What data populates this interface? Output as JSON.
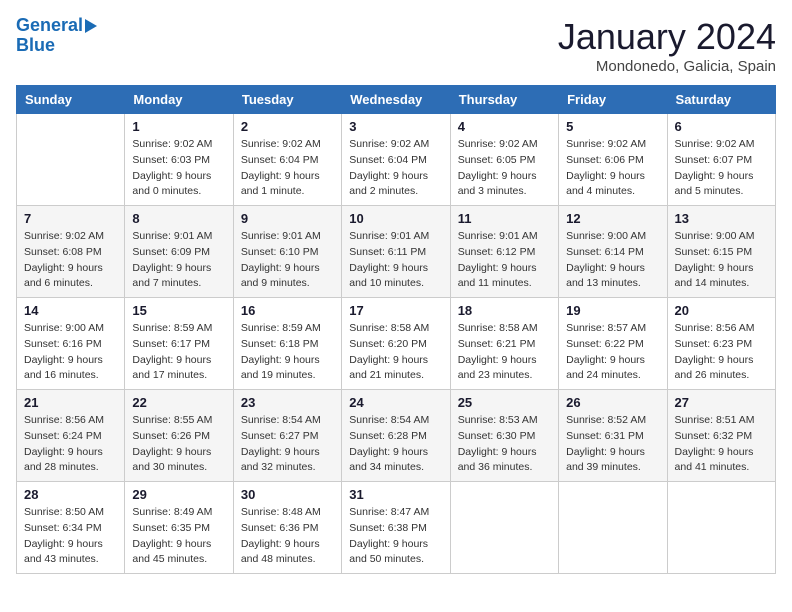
{
  "header": {
    "logo_line1": "General",
    "logo_line2": "Blue",
    "month": "January 2024",
    "location": "Mondonedo, Galicia, Spain"
  },
  "weekdays": [
    "Sunday",
    "Monday",
    "Tuesday",
    "Wednesday",
    "Thursday",
    "Friday",
    "Saturday"
  ],
  "weeks": [
    [
      {
        "day": "",
        "sunrise": "",
        "sunset": "",
        "daylight": ""
      },
      {
        "day": "1",
        "sunrise": "9:02 AM",
        "sunset": "6:03 PM",
        "daylight": "9 hours and 0 minutes."
      },
      {
        "day": "2",
        "sunrise": "9:02 AM",
        "sunset": "6:04 PM",
        "daylight": "9 hours and 1 minute."
      },
      {
        "day": "3",
        "sunrise": "9:02 AM",
        "sunset": "6:04 PM",
        "daylight": "9 hours and 2 minutes."
      },
      {
        "day": "4",
        "sunrise": "9:02 AM",
        "sunset": "6:05 PM",
        "daylight": "9 hours and 3 minutes."
      },
      {
        "day": "5",
        "sunrise": "9:02 AM",
        "sunset": "6:06 PM",
        "daylight": "9 hours and 4 minutes."
      },
      {
        "day": "6",
        "sunrise": "9:02 AM",
        "sunset": "6:07 PM",
        "daylight": "9 hours and 5 minutes."
      }
    ],
    [
      {
        "day": "7",
        "sunrise": "9:02 AM",
        "sunset": "6:08 PM",
        "daylight": "9 hours and 6 minutes."
      },
      {
        "day": "8",
        "sunrise": "9:01 AM",
        "sunset": "6:09 PM",
        "daylight": "9 hours and 7 minutes."
      },
      {
        "day": "9",
        "sunrise": "9:01 AM",
        "sunset": "6:10 PM",
        "daylight": "9 hours and 9 minutes."
      },
      {
        "day": "10",
        "sunrise": "9:01 AM",
        "sunset": "6:11 PM",
        "daylight": "9 hours and 10 minutes."
      },
      {
        "day": "11",
        "sunrise": "9:01 AM",
        "sunset": "6:12 PM",
        "daylight": "9 hours and 11 minutes."
      },
      {
        "day": "12",
        "sunrise": "9:00 AM",
        "sunset": "6:14 PM",
        "daylight": "9 hours and 13 minutes."
      },
      {
        "day": "13",
        "sunrise": "9:00 AM",
        "sunset": "6:15 PM",
        "daylight": "9 hours and 14 minutes."
      }
    ],
    [
      {
        "day": "14",
        "sunrise": "9:00 AM",
        "sunset": "6:16 PM",
        "daylight": "9 hours and 16 minutes."
      },
      {
        "day": "15",
        "sunrise": "8:59 AM",
        "sunset": "6:17 PM",
        "daylight": "9 hours and 17 minutes."
      },
      {
        "day": "16",
        "sunrise": "8:59 AM",
        "sunset": "6:18 PM",
        "daylight": "9 hours and 19 minutes."
      },
      {
        "day": "17",
        "sunrise": "8:58 AM",
        "sunset": "6:20 PM",
        "daylight": "9 hours and 21 minutes."
      },
      {
        "day": "18",
        "sunrise": "8:58 AM",
        "sunset": "6:21 PM",
        "daylight": "9 hours and 23 minutes."
      },
      {
        "day": "19",
        "sunrise": "8:57 AM",
        "sunset": "6:22 PM",
        "daylight": "9 hours and 24 minutes."
      },
      {
        "day": "20",
        "sunrise": "8:56 AM",
        "sunset": "6:23 PM",
        "daylight": "9 hours and 26 minutes."
      }
    ],
    [
      {
        "day": "21",
        "sunrise": "8:56 AM",
        "sunset": "6:24 PM",
        "daylight": "9 hours and 28 minutes."
      },
      {
        "day": "22",
        "sunrise": "8:55 AM",
        "sunset": "6:26 PM",
        "daylight": "9 hours and 30 minutes."
      },
      {
        "day": "23",
        "sunrise": "8:54 AM",
        "sunset": "6:27 PM",
        "daylight": "9 hours and 32 minutes."
      },
      {
        "day": "24",
        "sunrise": "8:54 AM",
        "sunset": "6:28 PM",
        "daylight": "9 hours and 34 minutes."
      },
      {
        "day": "25",
        "sunrise": "8:53 AM",
        "sunset": "6:30 PM",
        "daylight": "9 hours and 36 minutes."
      },
      {
        "day": "26",
        "sunrise": "8:52 AM",
        "sunset": "6:31 PM",
        "daylight": "9 hours and 39 minutes."
      },
      {
        "day": "27",
        "sunrise": "8:51 AM",
        "sunset": "6:32 PM",
        "daylight": "9 hours and 41 minutes."
      }
    ],
    [
      {
        "day": "28",
        "sunrise": "8:50 AM",
        "sunset": "6:34 PM",
        "daylight": "9 hours and 43 minutes."
      },
      {
        "day": "29",
        "sunrise": "8:49 AM",
        "sunset": "6:35 PM",
        "daylight": "9 hours and 45 minutes."
      },
      {
        "day": "30",
        "sunrise": "8:48 AM",
        "sunset": "6:36 PM",
        "daylight": "9 hours and 48 minutes."
      },
      {
        "day": "31",
        "sunrise": "8:47 AM",
        "sunset": "6:38 PM",
        "daylight": "9 hours and 50 minutes."
      },
      {
        "day": "",
        "sunrise": "",
        "sunset": "",
        "daylight": ""
      },
      {
        "day": "",
        "sunrise": "",
        "sunset": "",
        "daylight": ""
      },
      {
        "day": "",
        "sunrise": "",
        "sunset": "",
        "daylight": ""
      }
    ]
  ],
  "labels": {
    "sunrise_prefix": "Sunrise: ",
    "sunset_prefix": "Sunset: ",
    "daylight_prefix": "Daylight: "
  }
}
